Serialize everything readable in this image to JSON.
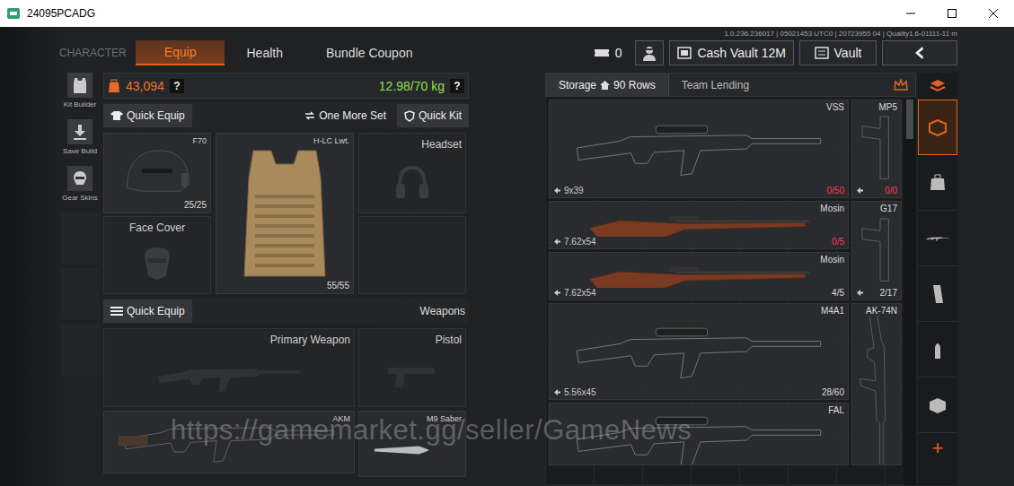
{
  "window": {
    "title": "24095PCADG"
  },
  "build_info": "1.0.236.236017 | 05021453 UTC0 | 20723955 04 | Quality1.6-01111-11 m",
  "nav": {
    "section": "CHARACTER",
    "tabs": [
      {
        "label": "Equip",
        "selected": true
      },
      {
        "label": "Health",
        "selected": false
      },
      {
        "label": "Bundle Coupon",
        "selected": false
      }
    ]
  },
  "top_right": {
    "tickets": "0",
    "cash_vault": "Cash Vault 12M",
    "vault": "Vault"
  },
  "sidebar": {
    "items": [
      {
        "label": "Kit Builder"
      },
      {
        "label": "Save Build"
      },
      {
        "label": "Gear Skins"
      }
    ]
  },
  "equip": {
    "value": "43,094",
    "weight": "12.98/70 kg",
    "help": "?",
    "quick_equip": "Quick Equip",
    "one_more_set": "One More Set",
    "quick_kit": "Quick Kit",
    "gear_slots": [
      {
        "kind": "item",
        "label": "F70",
        "durability": "25/25"
      },
      {
        "kind": "item",
        "label": "H-LC Lwt.",
        "durability": "55/55"
      },
      {
        "kind": "empty",
        "label": "Headset"
      },
      {
        "kind": "empty",
        "label": "Face Cover"
      },
      {
        "kind": "empty"
      }
    ],
    "weapons_quick_equip": "Quick Equip",
    "weapons_label": "Weapons",
    "weapon_slots": [
      {
        "kind": "empty",
        "label": "Primary Weapon"
      },
      {
        "kind": "empty",
        "label": "Pistol"
      },
      {
        "kind": "item",
        "label": "AKM"
      },
      {
        "kind": "item",
        "label": "M9 Saber"
      }
    ]
  },
  "storage": {
    "tabs": [
      {
        "label": "Storage",
        "badge": "90 Rows",
        "selected": true
      },
      {
        "label": "Team Lending",
        "selected": false
      }
    ],
    "items": [
      {
        "name": "VSS",
        "caliber": "9x39",
        "ammo": "0/50",
        "empty": true
      },
      {
        "name": "MP5",
        "ammo": "0/0",
        "empty": true
      },
      {
        "name": "Mosin",
        "caliber": "7.62x54",
        "ammo": "0/5",
        "empty": true
      },
      {
        "name": "G17",
        "ammo": "2/17",
        "empty": false
      },
      {
        "name": "Mosin",
        "caliber": "7.62x54",
        "ammo": "4/5",
        "empty": false
      },
      {
        "name": "M4A1",
        "caliber": "5.56x45",
        "ammo": "28/60",
        "empty": false
      },
      {
        "name": "AK-74N"
      },
      {
        "name": "FAL"
      }
    ]
  },
  "categories": [
    {
      "selected": true
    },
    {
      "selected": false
    },
    {
      "selected": false
    },
    {
      "selected": false
    },
    {
      "selected": false
    },
    {
      "selected": false
    }
  ],
  "add": "+",
  "watermark": "https://gamemarket.gg/seller/GameNews"
}
